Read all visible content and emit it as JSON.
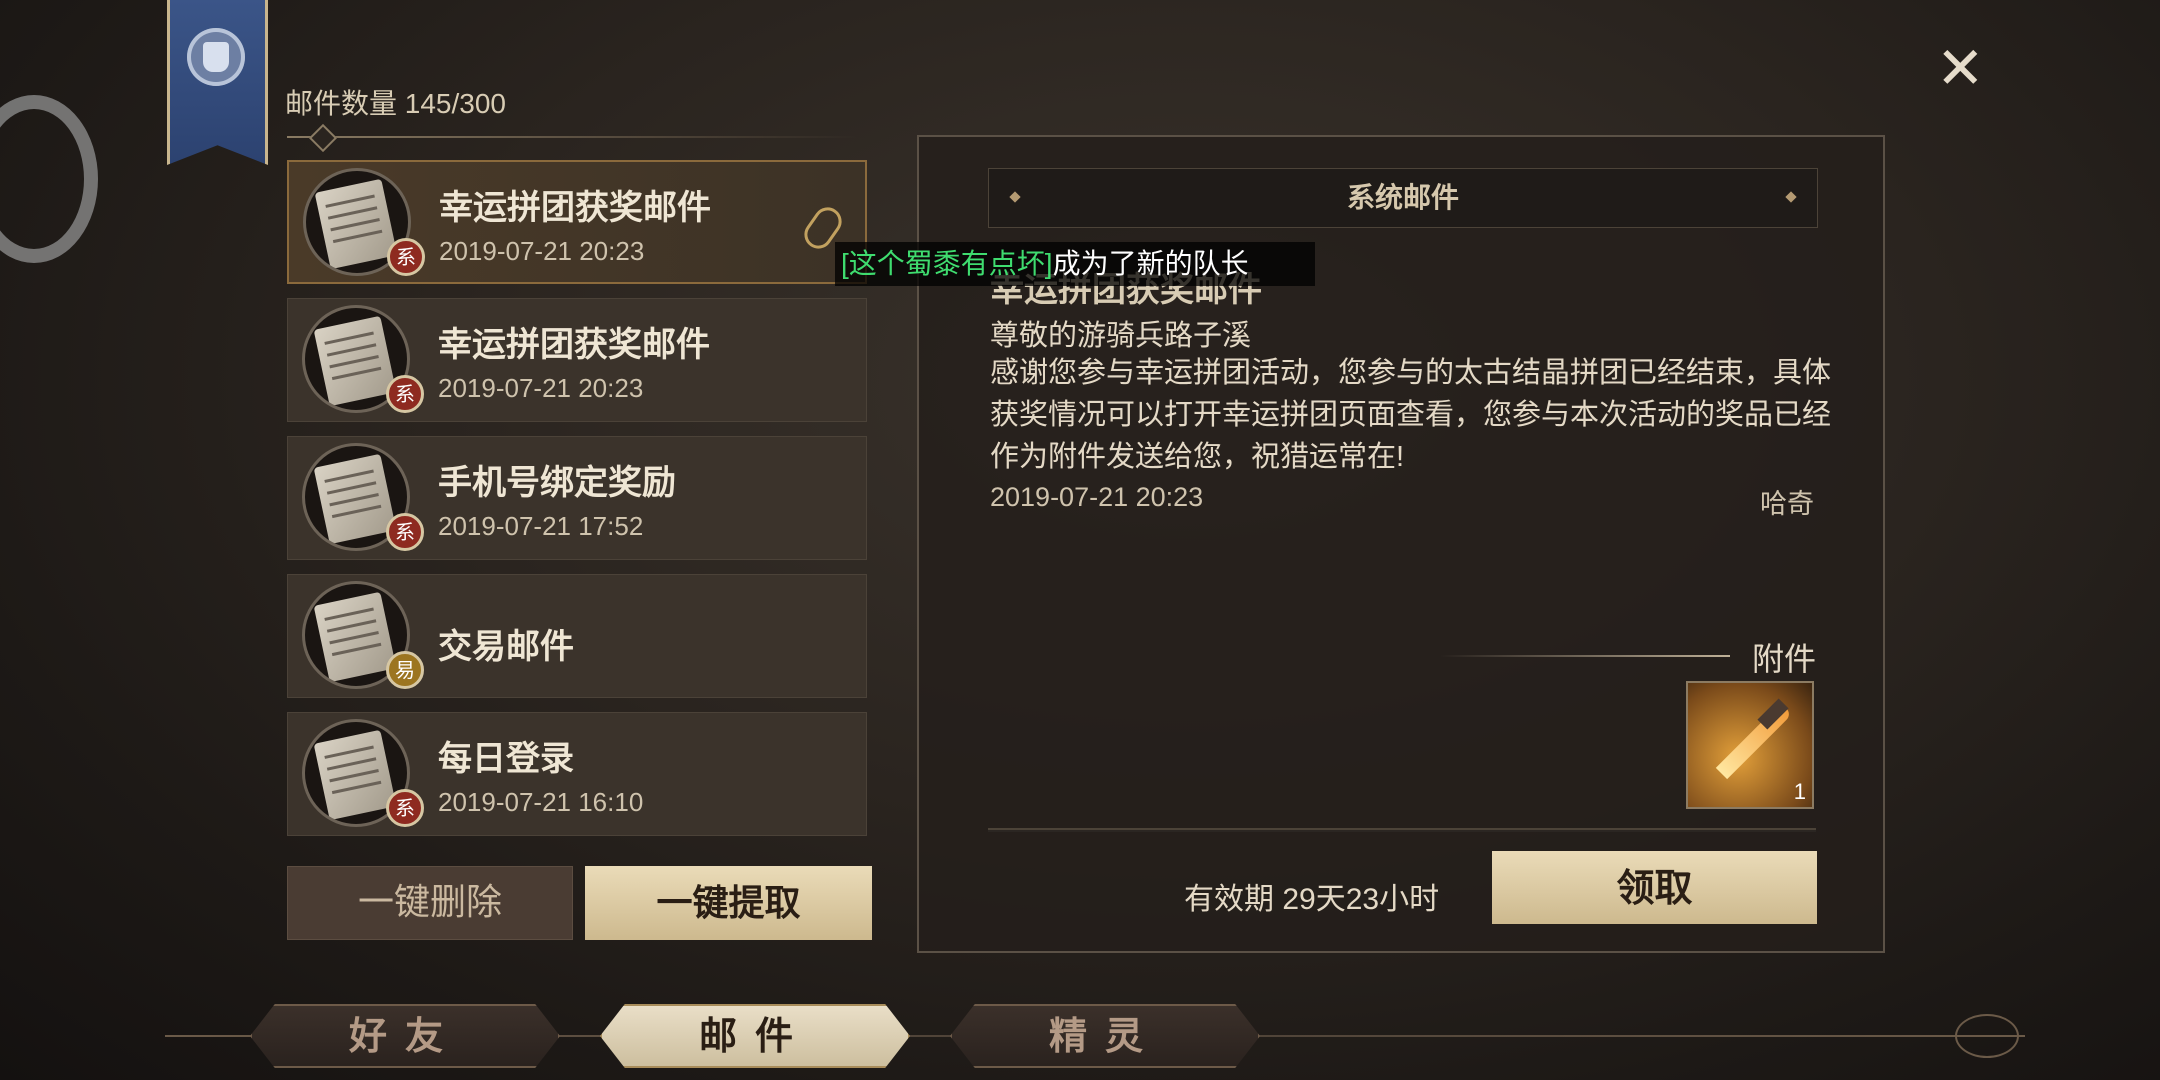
{
  "header": {
    "mail_count_label": "邮件数量 145/300",
    "close_label": "✕"
  },
  "mail_list": [
    {
      "title": "幸运拼团获奖邮件",
      "date": "2019-07-21 20:23",
      "badge": "系",
      "selected": true,
      "has_attachment": true
    },
    {
      "title": "幸运拼团获奖邮件",
      "date": "2019-07-21 20:23",
      "badge": "系",
      "selected": false,
      "has_attachment": false
    },
    {
      "title": "手机号绑定奖励",
      "date": "2019-07-21 17:52",
      "badge": "系",
      "selected": false,
      "has_attachment": false
    },
    {
      "title": "交易邮件",
      "date": "",
      "badge": "易",
      "selected": false,
      "has_attachment": false
    },
    {
      "title": "每日登录",
      "date": "2019-07-21 16:10",
      "badge": "系",
      "selected": false,
      "has_attachment": false
    }
  ],
  "actions": {
    "delete_all": "一键删除",
    "claim_all": "一键提取"
  },
  "detail": {
    "category": "系统邮件",
    "title": "幸运拼团获奖邮件",
    "greeting": "尊敬的游骑兵路子溪",
    "body": "感谢您参与幸运拼团活动，您参与的太古结晶拼团已经结束，具体获奖情况可以打开幸运拼团页面查看，您参与本次活动的奖品已经作为附件发送给您，祝猎运常在!",
    "date": "2019-07-21 20:23",
    "sender": "哈奇",
    "attachment_label": "附件",
    "attachment_count": "1",
    "attachment_icon": "dagger-icon",
    "validity": "有效期 29天23小时",
    "claim": "领取"
  },
  "chat": {
    "name": "[这个蜀黍有点坏]",
    "message": "成为了新的队长"
  },
  "tabs": [
    {
      "label": "好友",
      "active": false
    },
    {
      "label": "邮件",
      "active": true
    },
    {
      "label": "精灵",
      "active": false
    }
  ],
  "colors": {
    "accent_gold": "#c2a15f",
    "chat_name_green": "#3fdc6f",
    "badge_system_red": "#8e2a20",
    "badge_trade_gold": "#9c7520"
  }
}
